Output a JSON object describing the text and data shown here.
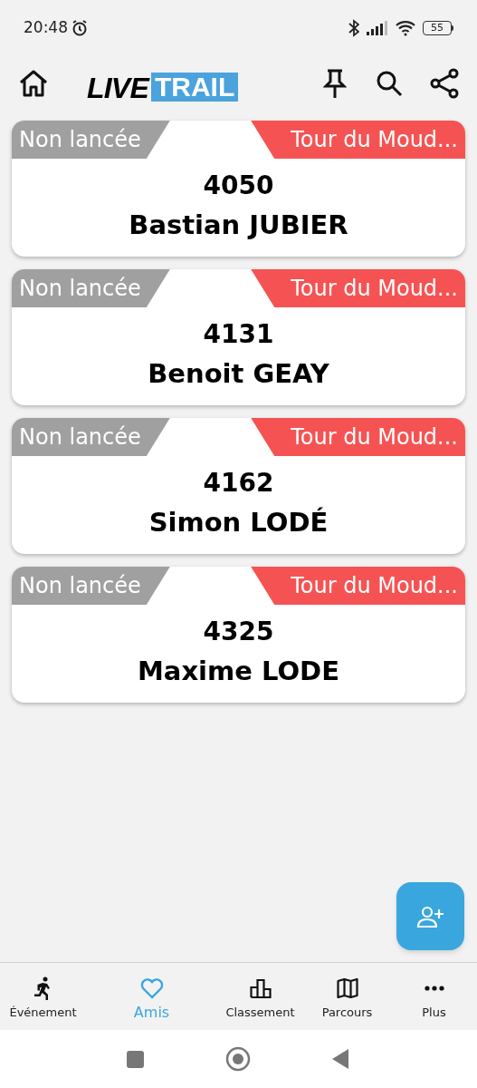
{
  "status_bar": {
    "time": "20:48",
    "battery": "55"
  },
  "header": {
    "logo": {
      "left": "LIVE",
      "right": "TRAIL"
    }
  },
  "cards": [
    {
      "status": "Non lancée",
      "race": "Tour du Moud...",
      "bib": "4050",
      "name": "Bastian JUBIER"
    },
    {
      "status": "Non lancée",
      "race": "Tour du Moud...",
      "bib": "4131",
      "name": "Benoit GEAY"
    },
    {
      "status": "Non lancée",
      "race": "Tour du Moud...",
      "bib": "4162",
      "name": "Simon LODÉ"
    },
    {
      "status": "Non lancée",
      "race": "Tour du Moud...",
      "bib": "4325",
      "name": "Maxime LODE"
    }
  ],
  "bottom_nav": [
    {
      "label": "Événement",
      "kind": "runner",
      "selected": false
    },
    {
      "label": "Amis",
      "kind": "heart",
      "selected": true
    },
    {
      "label": "Classement",
      "kind": "podium",
      "selected": false
    },
    {
      "label": "Parcours",
      "kind": "map",
      "selected": false
    },
    {
      "label": "Plus",
      "kind": "more",
      "selected": false
    }
  ]
}
